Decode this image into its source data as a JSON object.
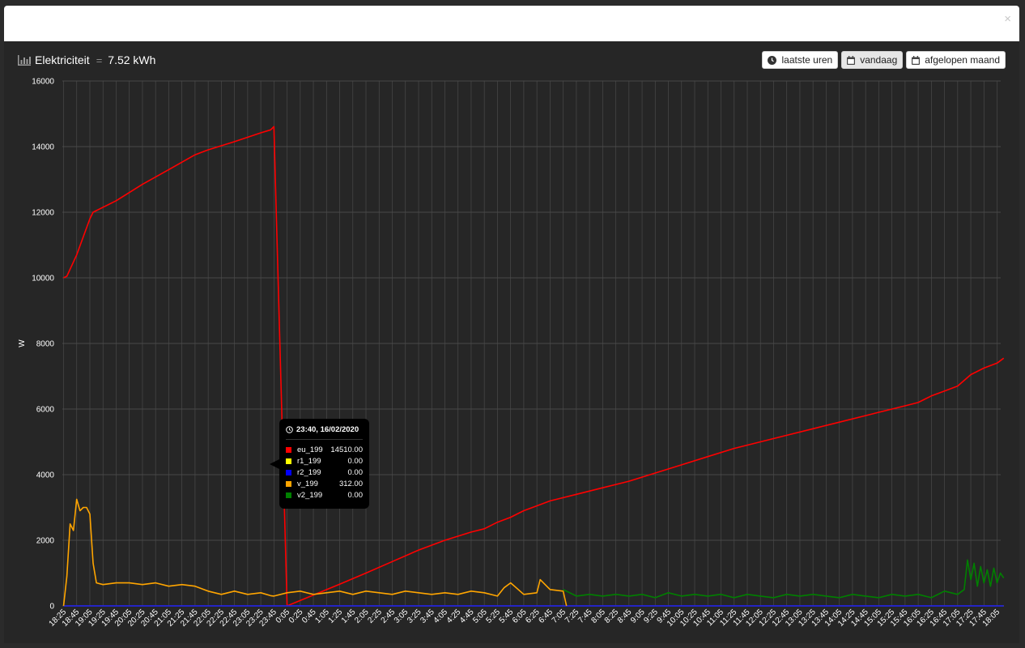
{
  "modal": {
    "close_glyph": "×"
  },
  "header": {
    "icon": "bar-chart-icon",
    "title": "Elektriciteit",
    "separator": "=",
    "total": "7.52 kWh"
  },
  "buttons": [
    {
      "label": "laatste uren",
      "icon": "clock-icon"
    },
    {
      "label": "vandaag",
      "icon": "calendar-icon",
      "active": true
    },
    {
      "label": "afgelopen maand",
      "icon": "calendar-icon"
    }
  ],
  "tooltip": {
    "title": "23:40, 16/02/2020",
    "rows": [
      {
        "name": "eu_199",
        "value": "14510.00",
        "color": "#ff0000"
      },
      {
        "name": "r1_199",
        "value": "0.00",
        "color": "#ffff00"
      },
      {
        "name": "r2_199",
        "value": "0.00",
        "color": "#0000ff"
      },
      {
        "name": "v_199",
        "value": "312.00",
        "color": "#ffa500"
      },
      {
        "name": "v2_199",
        "value": "0.00",
        "color": "#008000"
      }
    ]
  },
  "chart_data": {
    "type": "line",
    "ylabel": "W",
    "ylim": [
      0,
      16000
    ],
    "yticks": [
      0,
      2000,
      4000,
      6000,
      8000,
      10000,
      12000,
      14000,
      16000
    ],
    "xticks": [
      "18:25",
      "18:45",
      "19:05",
      "19:25",
      "19:45",
      "20:05",
      "20:25",
      "20:45",
      "21:05",
      "21:25",
      "21:45",
      "22:05",
      "22:25",
      "22:45",
      "23:05",
      "23:25",
      "23:45",
      "0:05",
      "0:25",
      "0:45",
      "1:05",
      "1:25",
      "1:45",
      "2:05",
      "2:25",
      "2:45",
      "3:05",
      "3:25",
      "3:45",
      "4:05",
      "4:25",
      "4:45",
      "5:05",
      "5:25",
      "5:45",
      "6:05",
      "6:25",
      "6:45",
      "7:05",
      "7:25",
      "7:45",
      "8:05",
      "8:25",
      "8:45",
      "9:05",
      "9:25",
      "9:45",
      "10:05",
      "10:25",
      "10:45",
      "11:05",
      "11:25",
      "11:45",
      "12:05",
      "12:25",
      "12:45",
      "13:05",
      "13:25",
      "13:45",
      "14:05",
      "14:25",
      "14:45",
      "15:05",
      "15:25",
      "15:45",
      "16:05",
      "16:25",
      "16:45",
      "17:05",
      "17:25",
      "17:45",
      "18:05"
    ],
    "grid": true,
    "series": [
      {
        "name": "eu_199",
        "color": "#ff0000",
        "x": [
          "18:25",
          "18:30",
          "18:45",
          "19:05",
          "19:10",
          "19:45",
          "20:25",
          "21:05",
          "21:45",
          "22:05",
          "22:45",
          "23:25",
          "23:40",
          "23:45",
          "0:05",
          "0:45",
          "1:25",
          "2:05",
          "2:45",
          "3:25",
          "4:05",
          "4:45",
          "5:05",
          "5:25",
          "5:45",
          "6:05",
          "6:25",
          "6:45",
          "7:05",
          "7:25",
          "8:05",
          "8:45",
          "9:25",
          "10:05",
          "10:45",
          "11:25",
          "12:05",
          "12:45",
          "13:25",
          "14:05",
          "14:45",
          "15:05",
          "15:45",
          "16:05",
          "16:25",
          "16:45",
          "17:05",
          "17:25",
          "17:45",
          "18:05",
          "18:15"
        ],
        "values": [
          10000,
          10050,
          10700,
          11800,
          12000,
          12350,
          12850,
          13300,
          13750,
          13900,
          14150,
          14420,
          14510,
          14610,
          0,
          330,
          660,
          1000,
          1350,
          1700,
          2000,
          2250,
          2350,
          2550,
          2700,
          2900,
          3050,
          3200,
          3300,
          3400,
          3600,
          3800,
          4050,
          4300,
          4550,
          4800,
          5000,
          5200,
          5400,
          5600,
          5800,
          5900,
          6100,
          6200,
          6400,
          6550,
          6700,
          7050,
          7250,
          7400,
          7550
        ]
      },
      {
        "name": "r1_199",
        "color": "#ffff00",
        "x": [
          "18:25",
          "18:15"
        ],
        "values": [
          0,
          0
        ]
      },
      {
        "name": "r2_199",
        "color": "#0000ff",
        "x": [
          "18:25",
          "18:15"
        ],
        "values": [
          0,
          0
        ]
      },
      {
        "name": "v_199",
        "color": "#ffa500",
        "x": [
          "18:25",
          "18:30",
          "18:35",
          "18:40",
          "18:45",
          "18:50",
          "18:55",
          "19:00",
          "19:05",
          "19:10",
          "19:15",
          "19:25",
          "19:45",
          "20:05",
          "20:25",
          "20:45",
          "21:05",
          "21:25",
          "21:45",
          "22:05",
          "22:25",
          "22:45",
          "23:05",
          "23:25",
          "23:40",
          "23:45",
          "0:05",
          "0:25",
          "0:45",
          "1:05",
          "1:25",
          "1:45",
          "2:05",
          "2:25",
          "2:45",
          "3:05",
          "3:25",
          "3:45",
          "4:05",
          "4:25",
          "4:45",
          "5:05",
          "5:25",
          "5:35",
          "5:45",
          "6:05",
          "6:25",
          "6:30",
          "6:45",
          "7:05",
          "7:10"
        ],
        "values": [
          0,
          900,
          2500,
          2300,
          3250,
          2900,
          3000,
          3000,
          2800,
          1300,
          700,
          650,
          700,
          700,
          650,
          700,
          600,
          650,
          600,
          450,
          350,
          450,
          350,
          400,
          312,
          300,
          400,
          450,
          350,
          400,
          450,
          350,
          450,
          400,
          350,
          450,
          400,
          350,
          400,
          350,
          450,
          400,
          300,
          550,
          700,
          350,
          400,
          800,
          500,
          450,
          0
        ]
      },
      {
        "name": "v2_199",
        "color": "#008000",
        "x": [
          "7:05",
          "7:25",
          "7:45",
          "8:05",
          "8:25",
          "8:45",
          "9:05",
          "9:25",
          "9:45",
          "10:05",
          "10:25",
          "10:45",
          "11:05",
          "11:25",
          "11:45",
          "12:05",
          "12:25",
          "12:45",
          "13:05",
          "13:25",
          "13:45",
          "14:05",
          "14:25",
          "14:45",
          "15:05",
          "15:25",
          "15:45",
          "16:05",
          "16:25",
          "16:45",
          "17:05",
          "17:15",
          "17:20",
          "17:25",
          "17:30",
          "17:35",
          "17:40",
          "17:45",
          "17:50",
          "17:55",
          "18:00",
          "18:05",
          "18:10",
          "18:15"
        ],
        "values": [
          500,
          300,
          350,
          300,
          350,
          300,
          350,
          250,
          400,
          300,
          350,
          300,
          350,
          250,
          350,
          300,
          250,
          350,
          300,
          350,
          300,
          250,
          350,
          300,
          250,
          350,
          300,
          350,
          250,
          450,
          350,
          500,
          1400,
          800,
          1300,
          600,
          1200,
          700,
          1100,
          600,
          1150,
          700,
          1000,
          850
        ]
      }
    ]
  }
}
